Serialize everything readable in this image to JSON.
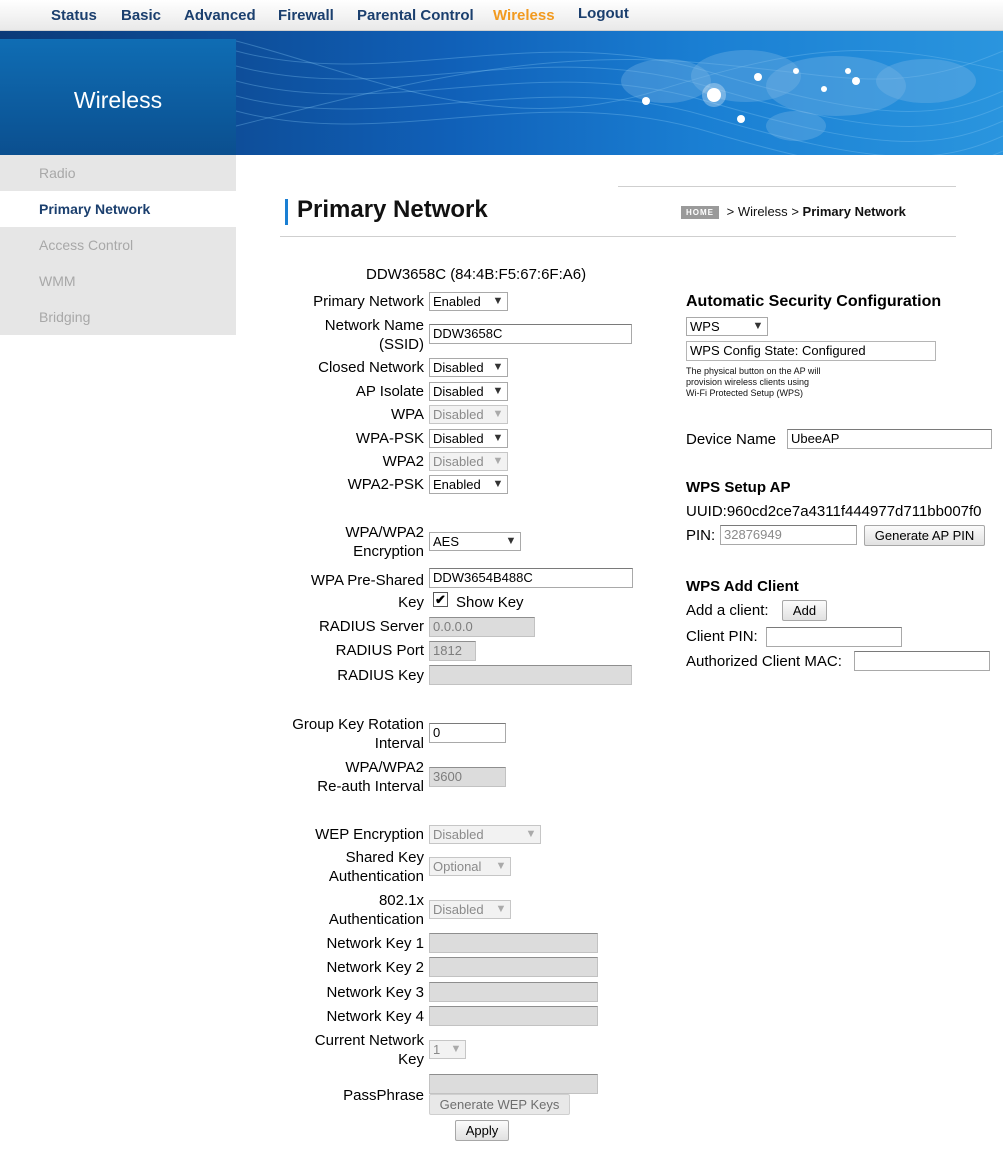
{
  "nav": [
    "Status",
    "Basic",
    "Advanced",
    "Firewall",
    "Parental Control",
    "Wireless",
    "Logout"
  ],
  "banner_title": "Wireless",
  "sidebar": [
    "Radio",
    "Primary Network",
    "Access Control",
    "WMM",
    "Bridging"
  ],
  "page_title": "Primary Network",
  "breadcrumb": {
    "home": "HOME",
    "sep1": ">",
    "section": "Wireless",
    "sep2": ">",
    "current": "Primary Network"
  },
  "device_header": "DDW3658C (84:4B:F5:67:6F:A6)",
  "form": {
    "primary_network": {
      "label": "Primary Network",
      "value": "Enabled"
    },
    "ssid": {
      "label1": "Network Name",
      "label2": "(SSID)",
      "value": "DDW3658C"
    },
    "closed_network": {
      "label": "Closed Network",
      "value": "Disabled"
    },
    "ap_isolate": {
      "label": "AP Isolate",
      "value": "Disabled"
    },
    "wpa": {
      "label": "WPA",
      "value": "Disabled"
    },
    "wpa_psk": {
      "label": "WPA-PSK",
      "value": "Disabled"
    },
    "wpa2": {
      "label": "WPA2",
      "value": "Disabled"
    },
    "wpa2_psk": {
      "label": "WPA2-PSK",
      "value": "Enabled"
    },
    "encryption": {
      "label1": "WPA/WPA2",
      "label2": "Encryption",
      "value": "AES"
    },
    "psk": {
      "label1": "WPA Pre-Shared",
      "label2": "Key",
      "value": "DDW3654B488C",
      "show_key": "Show Key",
      "show_key_checked": "✔"
    },
    "radius_server": {
      "label": "RADIUS Server",
      "value": "0.0.0.0"
    },
    "radius_port": {
      "label": "RADIUS Port",
      "value": "1812"
    },
    "radius_key": {
      "label": "RADIUS Key",
      "value": ""
    },
    "group_key": {
      "label1": "Group Key Rotation",
      "label2": "Interval",
      "value": "0"
    },
    "reauth": {
      "label1": "WPA/WPA2",
      "label2": "Re-auth Interval",
      "value": "3600"
    },
    "wep": {
      "label": "WEP Encryption",
      "value": "Disabled"
    },
    "shared_key": {
      "label1": "Shared Key",
      "label2": "Authentication",
      "value": "Optional"
    },
    "auth_8021x": {
      "label1": "802.1x",
      "label2": "Authentication",
      "value": "Disabled"
    },
    "network_key_1": {
      "label": "Network Key 1",
      "value": ""
    },
    "network_key_2": {
      "label": "Network Key 2",
      "value": ""
    },
    "network_key_3": {
      "label": "Network Key 3",
      "value": ""
    },
    "network_key_4": {
      "label": "Network Key 4",
      "value": ""
    },
    "current_key": {
      "label1": "Current Network",
      "label2": "Key",
      "value": "1"
    },
    "passphrase": {
      "label": "PassPhrase",
      "value": ""
    },
    "generate_wep": "Generate WEP Keys",
    "apply": "Apply"
  },
  "right": {
    "asc_title": "Automatic Security Configuration",
    "wps_select": "WPS",
    "wps_state": "WPS Config State: Configured",
    "wps_note": [
      "The physical button on the AP will",
      "provision wireless clients using",
      "Wi-Fi Protected Setup (WPS)"
    ],
    "device_name_label": "Device Name",
    "device_name_value": "UbeeAP",
    "wps_setup_title": "WPS Setup AP",
    "uuid": "UUID:960cd2ce7a4311f444977d711bb007f0",
    "pin_label": "PIN:",
    "pin_value": "32876949",
    "generate_pin": "Generate AP PIN",
    "wps_add_title": "WPS Add Client",
    "add_client_label": "Add a client:",
    "add_button": "Add",
    "client_pin_label": "Client PIN:",
    "client_pin_value": "",
    "auth_mac_label": "Authorized Client MAC:",
    "auth_mac_value": ""
  },
  "colors": {
    "nav_text": "#1b3f6e",
    "nav_active": "#f29a1f",
    "banner": "#0b4f8f",
    "accent": "#1a7fd3"
  }
}
